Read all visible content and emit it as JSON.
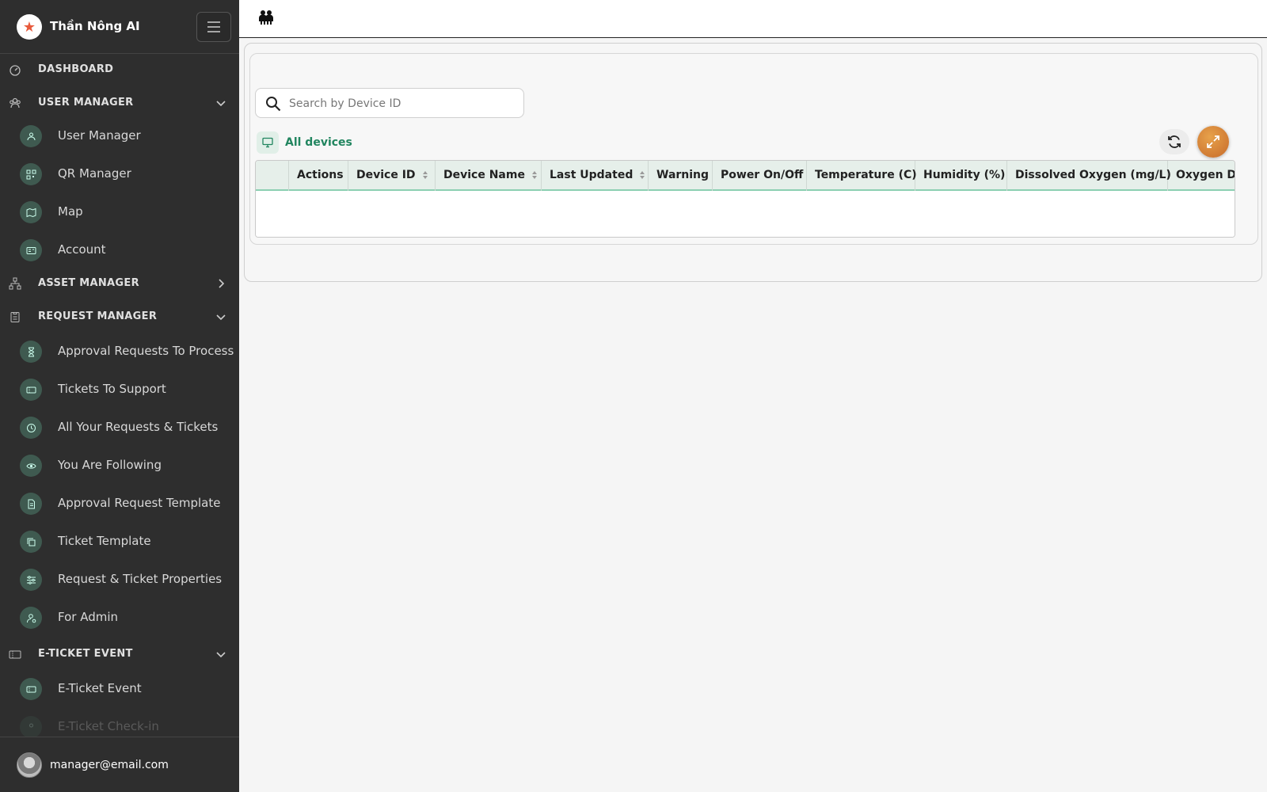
{
  "brand": {
    "name": "Thần Nông AI"
  },
  "sidebar": {
    "sections": [
      {
        "label": "DASHBOARD"
      },
      {
        "label": "USER MANAGER"
      },
      {
        "label": "ASSET MANAGER"
      },
      {
        "label": "REQUEST MANAGER"
      },
      {
        "label": "E-TICKET EVENT"
      }
    ],
    "user_manager_items": [
      {
        "label": "User Manager"
      },
      {
        "label": "QR Manager"
      },
      {
        "label": "Map"
      },
      {
        "label": "Account"
      }
    ],
    "request_manager_items": [
      {
        "label": "Approval Requests To Process"
      },
      {
        "label": "Tickets To Support"
      },
      {
        "label": "All Your Requests & Tickets"
      },
      {
        "label": "You Are Following"
      },
      {
        "label": "Approval Request Template"
      },
      {
        "label": "Ticket Template"
      },
      {
        "label": "Request & Ticket Properties"
      },
      {
        "label": "For Admin"
      }
    ],
    "eticket_items": [
      {
        "label": "E-Ticket Event"
      },
      {
        "label": "E-Ticket Check-in"
      }
    ]
  },
  "user": {
    "email": "manager@email.com"
  },
  "search": {
    "placeholder": "Search by Device ID"
  },
  "devices": {
    "label": "All devices"
  },
  "table": {
    "columns": [
      {
        "label": ""
      },
      {
        "label": "Actions"
      },
      {
        "label": "Device ID"
      },
      {
        "label": "Device Name"
      },
      {
        "label": "Last Updated"
      },
      {
        "label": "Warning"
      },
      {
        "label": "Power On/Off"
      },
      {
        "label": "Temperature (C)"
      },
      {
        "label": "Humidity (%)"
      },
      {
        "label": "Dissolved Oxygen (mg/L)"
      },
      {
        "label": "Oxygen Demand"
      }
    ]
  },
  "colors": {
    "sidebar_bg": "#2e2e2e",
    "accent_green": "#21855f",
    "header_underline": "#8ccfb2",
    "expand_orange": "#d9843a"
  }
}
